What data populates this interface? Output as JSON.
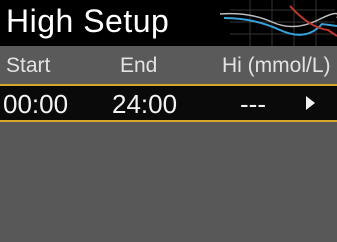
{
  "screen": {
    "title": "High Setup",
    "columns": {
      "start": "Start",
      "end": "End",
      "hi": "Hi (mmol/L)"
    },
    "rows": [
      {
        "start": "00:00",
        "end": "24:00",
        "hi": "---"
      }
    ],
    "colors": {
      "background": "#585858",
      "title_bar": "#000000",
      "selection_border": "#d8a72a",
      "selected_row_bg": "#0a0a0a",
      "graph_red": "#c0392b",
      "graph_blue": "#3aa0d8"
    },
    "icons": {
      "row_arrow": "chevron-right-icon",
      "header_art": "graph-icon"
    }
  }
}
